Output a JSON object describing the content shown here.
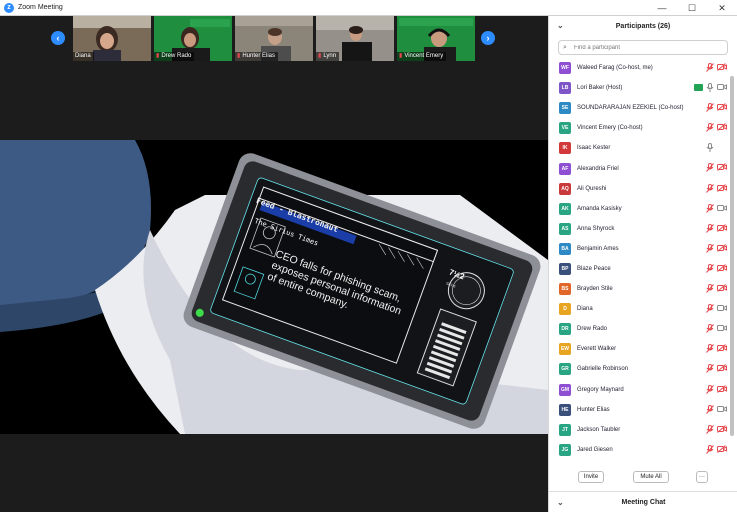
{
  "window": {
    "title": "Zoom Meeting",
    "minimize": "—",
    "maximize": "☐",
    "close": "✕"
  },
  "gallery": {
    "prev_icon": "chevron-left-icon",
    "next_icon": "chevron-right-icon",
    "thumbs": [
      {
        "name": "Diana",
        "bg": "#6b5a4a",
        "muted": false
      },
      {
        "name": "Drew Rado",
        "bg": "#1f8f3f",
        "muted": true
      },
      {
        "name": "Hunter Elias",
        "bg": "#7c7468",
        "muted": true
      },
      {
        "name": "Lynn",
        "bg": "#8a8680",
        "muted": true
      },
      {
        "name": "Vincent Emery",
        "bg": "#1f8f3f",
        "muted": true
      }
    ]
  },
  "share": {
    "feed_title": "Feed - Blastronaut",
    "outlet": "The Sirius Times",
    "headline": "CEO falls for phishing scam, exposes personal information of entire company.",
    "badge_value": "7½2",
    "badge_sub": "Sirius"
  },
  "participants": {
    "title": "Participants (26)",
    "search_placeholder": "Find a participant",
    "items": [
      {
        "initials": "WF",
        "name": "Waleed Farag (Co-host, me)",
        "color": "#8e4fd3",
        "mic": "muted",
        "video": "off"
      },
      {
        "initials": "LB",
        "name": "Lori Baker (Host)",
        "color": "#7f56c8",
        "mic": "on",
        "video": "on",
        "share": true
      },
      {
        "initials": "SE",
        "name": "SOUNDARARAJAN EZEKIEL (Co-host)",
        "color": "#2e8ac4",
        "mic": "muted",
        "video": "off"
      },
      {
        "initials": "VE",
        "name": "Vincent Emery (Co-host)",
        "color": "#2aa583",
        "mic": "muted",
        "video": "off"
      },
      {
        "initials": "IK",
        "name": "Isaac Kester",
        "color": "#d23a3a",
        "mic": "on",
        "video": "none"
      },
      {
        "initials": "AF",
        "name": "Alexandria Friel",
        "color": "#8e4fd3",
        "mic": "muted",
        "video": "off"
      },
      {
        "initials": "AQ",
        "name": "Ali Qureshi",
        "color": "#c93a3a",
        "mic": "muted",
        "video": "off"
      },
      {
        "initials": "AK",
        "name": "Amanda Kasisky",
        "color": "#2aa583",
        "mic": "muted",
        "video": "on"
      },
      {
        "initials": "AS",
        "name": "Anna Shyrock",
        "color": "#2aa583",
        "mic": "muted",
        "video": "off"
      },
      {
        "initials": "BA",
        "name": "Benjamin Ames",
        "color": "#2e8ac4",
        "mic": "muted",
        "video": "off"
      },
      {
        "initials": "BP",
        "name": "Blaze Peace",
        "color": "#3a4f7a",
        "mic": "muted",
        "video": "off"
      },
      {
        "initials": "BS",
        "name": "Brayden Stile",
        "color": "#e0662a",
        "mic": "muted",
        "video": "off"
      },
      {
        "initials": "D",
        "name": "Diana",
        "color": "#e7a521",
        "mic": "muted",
        "video": "on"
      },
      {
        "initials": "DR",
        "name": "Drew Rado",
        "color": "#2aa583",
        "mic": "muted",
        "video": "on"
      },
      {
        "initials": "EW",
        "name": "Everett Walker",
        "color": "#e7a521",
        "mic": "muted",
        "video": "off"
      },
      {
        "initials": "GR",
        "name": "Gabrielle Robinson",
        "color": "#2aa583",
        "mic": "muted",
        "video": "off"
      },
      {
        "initials": "GM",
        "name": "Gregory Maynard",
        "color": "#8e4fd3",
        "mic": "muted",
        "video": "off"
      },
      {
        "initials": "HE",
        "name": "Hunter Elias",
        "color": "#3a4f7a",
        "mic": "muted",
        "video": "on"
      },
      {
        "initials": "JT",
        "name": "Jackson Taubler",
        "color": "#2aa583",
        "mic": "muted",
        "video": "off"
      },
      {
        "initials": "JG",
        "name": "Jared Giesen",
        "color": "#2aa583",
        "mic": "muted",
        "video": "off"
      }
    ],
    "invite_label": "Invite",
    "mute_all_label": "Mute All",
    "more_label": "···"
  },
  "chat": {
    "title": "Meeting Chat"
  },
  "colors": {
    "muted_red": "#e5484d",
    "accent": "#2d8cff",
    "icon_gray": "#8a8a8a"
  }
}
